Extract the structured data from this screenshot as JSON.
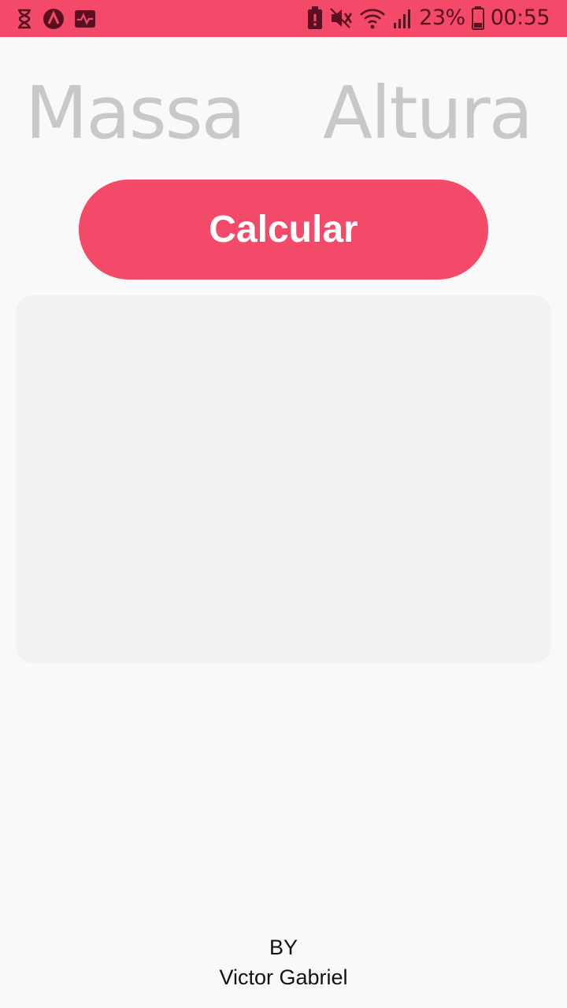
{
  "status_bar": {
    "battery_percent": "23%",
    "time": "00:55",
    "left_icons": [
      "hourglass-icon",
      "app-a-icon",
      "activity-monitor-icon"
    ],
    "right_icons": [
      "battery-alert-icon",
      "muted-sound-icon",
      "wifi-icon",
      "signal-icon",
      "battery-icon"
    ],
    "colors": {
      "background": "#f24a68",
      "icons": "#5a1020"
    }
  },
  "form": {
    "massa_placeholder": "Massa",
    "altura_placeholder": "Altura",
    "calculate_label": "Calcular"
  },
  "result": {
    "text": ""
  },
  "footer": {
    "by_label": "BY",
    "author": "Victor Gabriel"
  },
  "colors": {
    "accent": "#f24a68",
    "page_background": "#f9f9f9",
    "card_background": "#f2f2f2",
    "placeholder_text": "#c8c8c8"
  }
}
